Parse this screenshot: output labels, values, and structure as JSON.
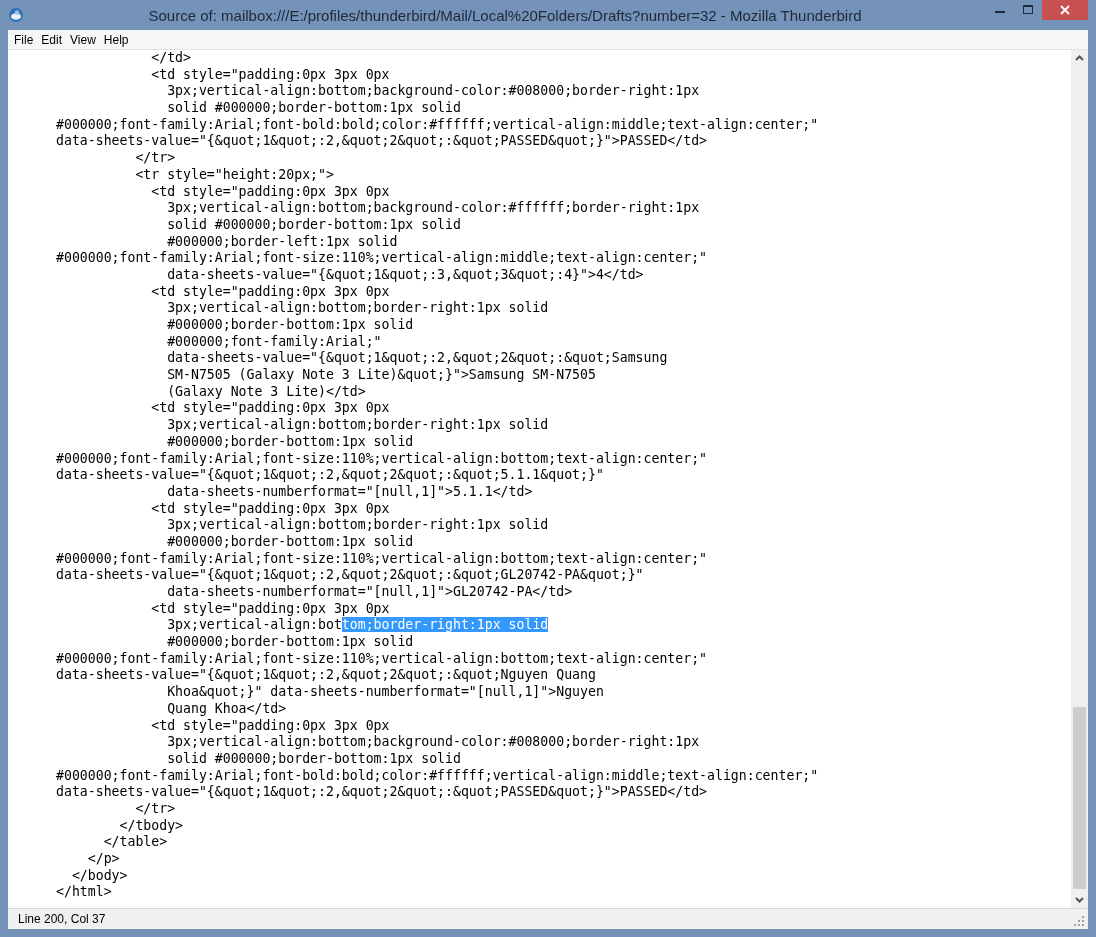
{
  "window": {
    "title": "Source of: mailbox:///E:/profiles/thunderbird/Mail/Local%20Folders/Drafts?number=32 - Mozilla Thunderbird"
  },
  "menu": [
    "File",
    "Edit",
    "View",
    "Help"
  ],
  "source_lines": [
    {
      "text": "            </td>"
    },
    {
      "text": "            <td style=\"padding:0px 3px 0px"
    },
    {
      "text": "              3px;vertical-align:bottom;background-color:#008000;border-right:1px"
    },
    {
      "text": "              solid #000000;border-bottom:1px solid"
    },
    {
      "text": "#000000;font-family:Arial;font-bold:bold;color:#ffffff;vertical-align:middle;text-align:center;\""
    },
    {
      "text": "data-sheets-value=\"{&quot;1&quot;:2,&quot;2&quot;:&quot;PASSED&quot;}\">PASSED</td>"
    },
    {
      "text": "          </tr>"
    },
    {
      "text": "          <tr style=\"height:20px;\">"
    },
    {
      "text": "            <td style=\"padding:0px 3px 0px"
    },
    {
      "text": "              3px;vertical-align:bottom;background-color:#ffffff;border-right:1px"
    },
    {
      "text": "              solid #000000;border-bottom:1px solid"
    },
    {
      "text": "              #000000;border-left:1px solid"
    },
    {
      "text": "#000000;font-family:Arial;font-size:110%;vertical-align:middle;text-align:center;\""
    },
    {
      "text": "              data-sheets-value=\"{&quot;1&quot;:3,&quot;3&quot;:4}\">4</td>"
    },
    {
      "text": "            <td style=\"padding:0px 3px 0px"
    },
    {
      "text": "              3px;vertical-align:bottom;border-right:1px solid"
    },
    {
      "text": "              #000000;border-bottom:1px solid"
    },
    {
      "text": "              #000000;font-family:Arial;\""
    },
    {
      "text": "              data-sheets-value=\"{&quot;1&quot;:2,&quot;2&quot;:&quot;Samsung"
    },
    {
      "text": "              SM-N7505 (Galaxy Note 3 Lite)&quot;}\">Samsung SM-N7505"
    },
    {
      "text": "              (Galaxy Note 3 Lite)</td>"
    },
    {
      "text": "            <td style=\"padding:0px 3px 0px"
    },
    {
      "text": "              3px;vertical-align:bottom;border-right:1px solid"
    },
    {
      "text": "              #000000;border-bottom:1px solid"
    },
    {
      "text": "#000000;font-family:Arial;font-size:110%;vertical-align:bottom;text-align:center;\""
    },
    {
      "text": "data-sheets-value=\"{&quot;1&quot;:2,&quot;2&quot;:&quot;5.1.1&quot;}\""
    },
    {
      "text": "              data-sheets-numberformat=\"[null,1]\">5.1.1</td>"
    },
    {
      "text": "            <td style=\"padding:0px 3px 0px"
    },
    {
      "text": "              3px;vertical-align:bottom;border-right:1px solid"
    },
    {
      "text": "              #000000;border-bottom:1px solid"
    },
    {
      "text": "#000000;font-family:Arial;font-size:110%;vertical-align:bottom;text-align:center;\""
    },
    {
      "text": "data-sheets-value=\"{&quot;1&quot;:2,&quot;2&quot;:&quot;GL20742-PA&quot;}\""
    },
    {
      "text": "              data-sheets-numberformat=\"[null,1]\">GL20742-PA</td>"
    },
    {
      "text": "            <td style=\"padding:0px 3px 0px"
    },
    {
      "text": "              3px;vertical-align:bot",
      "selection": "tom;border-right:1px solid"
    },
    {
      "text": "              #000000;border-bottom:1px solid"
    },
    {
      "text": "#000000;font-family:Arial;font-size:110%;vertical-align:bottom;text-align:center;\""
    },
    {
      "text": "data-sheets-value=\"{&quot;1&quot;:2,&quot;2&quot;:&quot;Nguyen Quang"
    },
    {
      "text": "              Khoa&quot;}\" data-sheets-numberformat=\"[null,1]\">Nguyen"
    },
    {
      "text": "              Quang Khoa</td>"
    },
    {
      "text": "            <td style=\"padding:0px 3px 0px"
    },
    {
      "text": "              3px;vertical-align:bottom;background-color:#008000;border-right:1px"
    },
    {
      "text": "              solid #000000;border-bottom:1px solid"
    },
    {
      "text": "#000000;font-family:Arial;font-bold:bold;color:#ffffff;vertical-align:middle;text-align:center;\""
    },
    {
      "text": "data-sheets-value=\"{&quot;1&quot;:2,&quot;2&quot;:&quot;PASSED&quot;}\">PASSED</td>"
    },
    {
      "text": "          </tr>"
    },
    {
      "text": "        </tbody>"
    },
    {
      "text": "      </table>"
    },
    {
      "text": "    </p>"
    },
    {
      "text": "  </body>"
    },
    {
      "text": "</html>"
    }
  ],
  "status_bar": "Line 200, Col 37"
}
